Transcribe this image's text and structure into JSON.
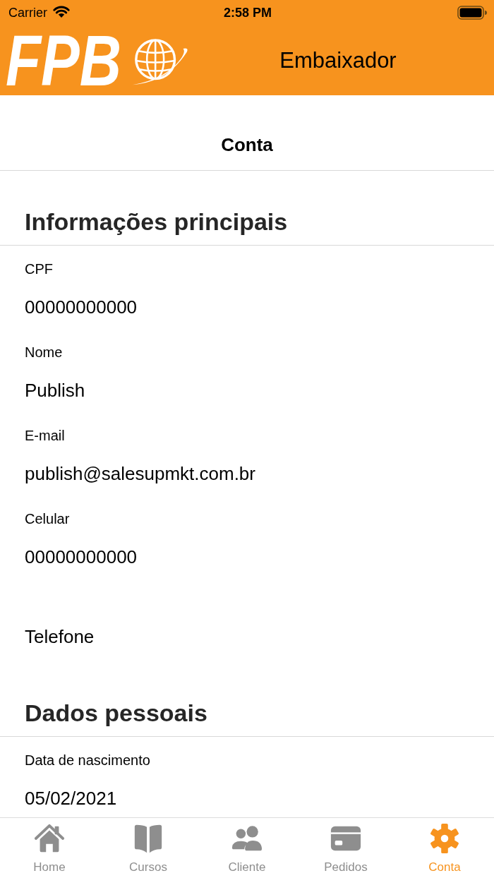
{
  "status_bar": {
    "carrier": "Carrier",
    "time": "2:58 PM"
  },
  "header": {
    "logo": "FPB",
    "title": "Embaixador"
  },
  "page_title": "Conta",
  "sections": [
    {
      "title": "Informações principais",
      "fields": [
        {
          "label": "CPF",
          "value": "00000000000"
        },
        {
          "label": "Nome",
          "value": "Publish"
        },
        {
          "label": "E-mail",
          "value": "publish@salesupmkt.com.br"
        },
        {
          "label": "Celular",
          "value": "00000000000"
        },
        {
          "label": "Telefone"
        }
      ]
    },
    {
      "title": "Dados pessoais",
      "fields": [
        {
          "label": "Data de nascimento",
          "value": "05/02/2021"
        }
      ]
    }
  ],
  "tab_bar": [
    {
      "label": "Home",
      "selected": false
    },
    {
      "label": "Cursos",
      "selected": false
    },
    {
      "label": "Cliente",
      "selected": false
    },
    {
      "label": "Pedidos",
      "selected": false
    },
    {
      "label": "Conta",
      "selected": true
    }
  ]
}
